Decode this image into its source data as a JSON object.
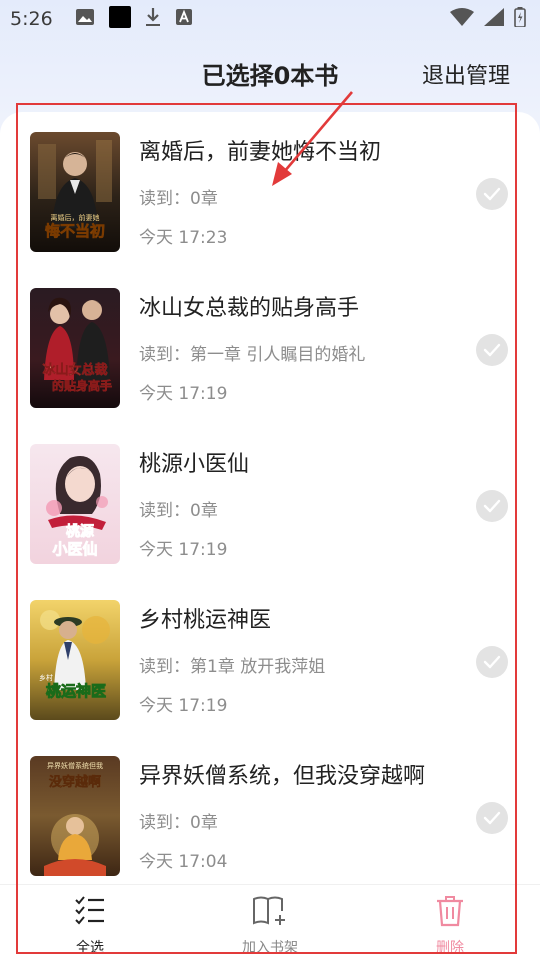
{
  "status_bar": {
    "time": "5:26",
    "icons": [
      "image-icon",
      "black-square-icon",
      "download-icon",
      "text-icon"
    ],
    "right_icons": [
      "wifi-icon",
      "signal-icon",
      "battery-icon"
    ]
  },
  "header": {
    "title": "已选择0本书",
    "exit_label": "退出管理"
  },
  "books": [
    {
      "title": "离婚后，前妻她悔不当初",
      "progress": "读到：0章",
      "time": "今天 17:23",
      "cover_text": "悔不当初",
      "cover_subtext": "离婚后，前妻她"
    },
    {
      "title": "冰山女总裁的贴身高手",
      "progress": "读到：第一章 引人瞩目的婚礼",
      "time": "今天 17:19",
      "cover_text": "冰山女总裁",
      "cover_subtext": "的贴身高手"
    },
    {
      "title": "桃源小医仙",
      "progress": "读到：0章",
      "time": "今天 17:19",
      "cover_text": "桃源",
      "cover_subtext": "小医仙"
    },
    {
      "title": "乡村桃运神医",
      "progress": "读到：第1章 放开我萍姐",
      "time": "今天 17:19",
      "cover_text": "桃运神医",
      "cover_subtext": "乡村"
    },
    {
      "title": "异界妖僧系统，但我没穿越啊",
      "progress": "读到：0章",
      "time": "今天 17:04",
      "cover_text": "没穿越啊",
      "cover_subtext": "异界妖僧系统但我"
    }
  ],
  "bottom_bar": {
    "select_all": "全选",
    "add_to_shelf": "加入书架",
    "delete": "删除"
  },
  "colors": {
    "accent_red": "#e23a3a",
    "delete_pink": "#f08aa0",
    "muted": "#8d8d8d"
  }
}
